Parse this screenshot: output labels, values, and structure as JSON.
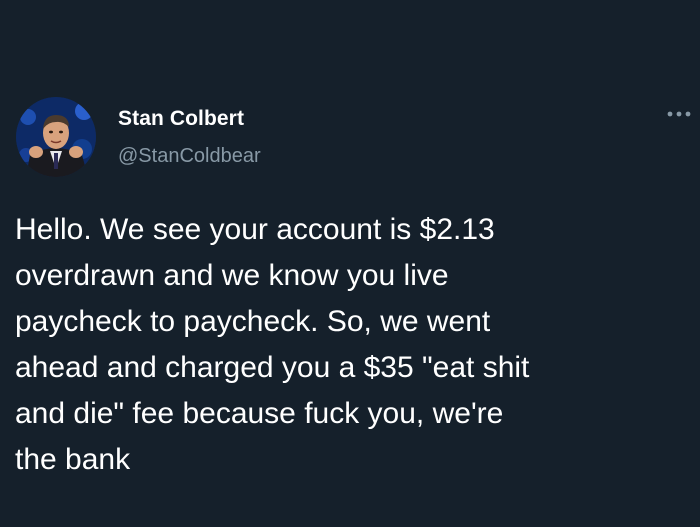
{
  "tweet": {
    "author": {
      "display_name": "Stan Colbert",
      "handle": "@StanColdbear",
      "avatar_icon": "profile-photo"
    },
    "more_options_icon": "more-horizontal-icon",
    "body_lines": [
      "Hello. We see your account is $2.13",
      "overdrawn and we know you live",
      "paycheck to paycheck. So, we went",
      "ahead and charged you a $35 \"eat shit",
      "and die\" fee because fuck you, we're",
      "the bank"
    ]
  },
  "colors": {
    "background": "#15202b",
    "primary_text": "#ffffff",
    "secondary_text": "#8899a6"
  }
}
